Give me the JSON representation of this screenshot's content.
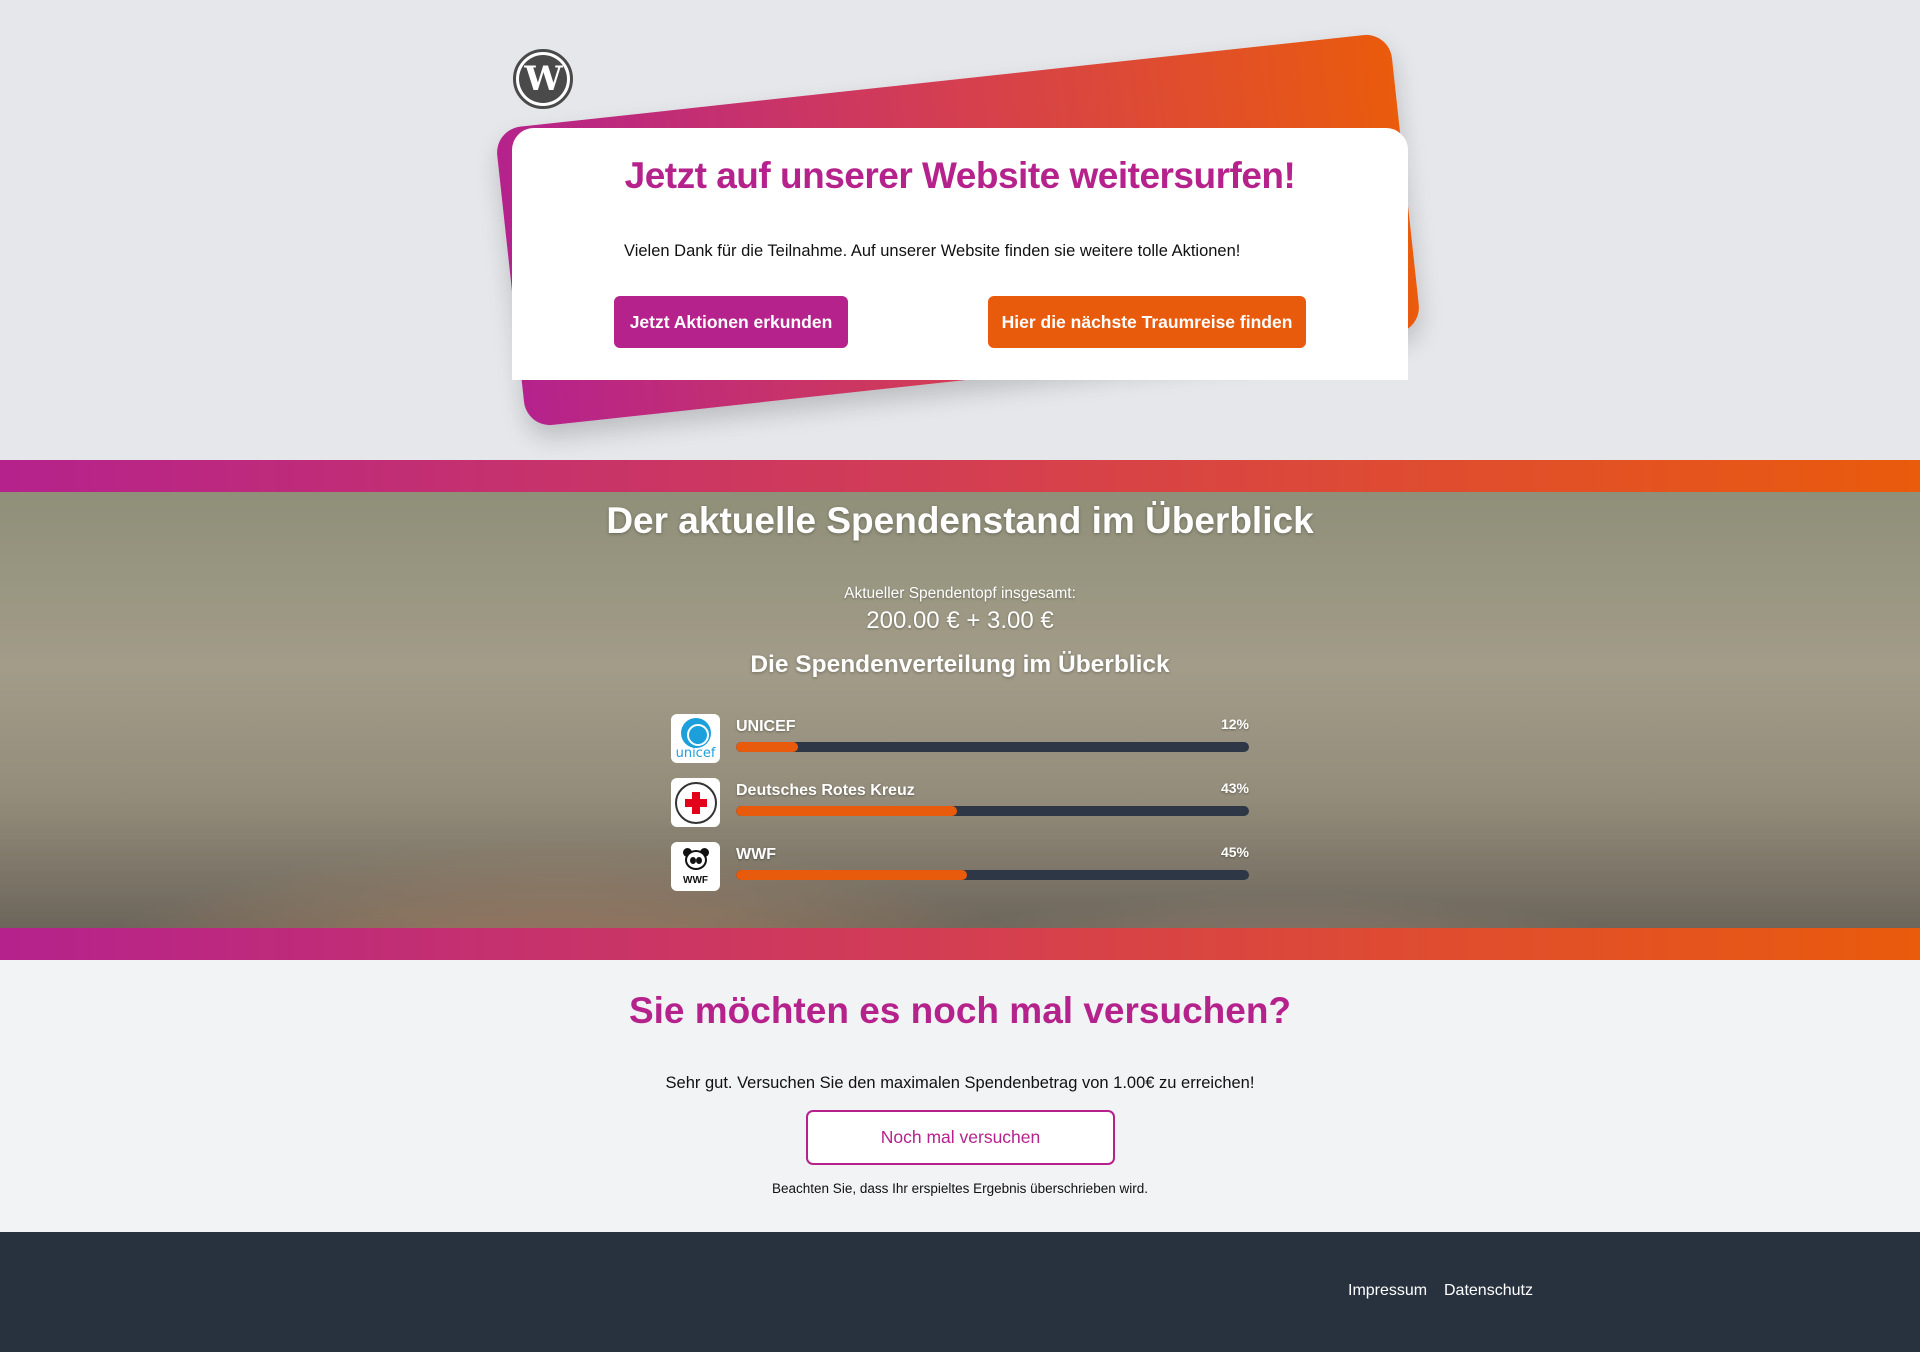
{
  "header": {
    "logo_icon": "wordpress-logo-icon",
    "logo_glyph": "W",
    "title": "Jetzt auf unserer Website weitersurfen!",
    "text": "Vielen Dank für die Teilnahme. Auf unserer Website finden sie weitere tolle Aktionen!",
    "button_actions": "Jetzt Aktionen erkunden",
    "button_travel": "Hier die nächste Traumreise finden"
  },
  "donation": {
    "title": "Der aktuelle Spendenstand im Überblick",
    "total_label": "Aktueller Spendentopf insgesamt:",
    "total_value": "200.00 € + 3.00 €",
    "distribution_title": "Die Spendenverteilung im Überblick",
    "organizations": [
      {
        "name": "UNICEF",
        "percent_label": "12%",
        "percent": 12,
        "logo_icon": "unicef-logo-icon",
        "logo_text": "unicef"
      },
      {
        "name": "Deutsches Rotes Kreuz",
        "percent_label": "43%",
        "percent": 43,
        "logo_icon": "red-cross-logo-icon"
      },
      {
        "name": "WWF",
        "percent_label": "45%",
        "percent": 45,
        "logo_icon": "wwf-panda-logo-icon",
        "logo_text": "WWF"
      }
    ]
  },
  "retry": {
    "title": "Sie möchten es noch mal versuchen?",
    "text": "Sehr gut. Versuchen Sie den maximalen Spendenbetrag von 1.00€ zu erreichen!",
    "button": "Noch mal versuchen",
    "note": "Beachten Sie, dass Ihr erspieltes Ergebnis überschrieben wird."
  },
  "footer": {
    "links": [
      "Impressum",
      "Datenschutz"
    ]
  },
  "colors": {
    "primary": "#b5228c",
    "secondary": "#e95b0c",
    "footer_bg": "#28323e",
    "track": "#2e3746"
  }
}
